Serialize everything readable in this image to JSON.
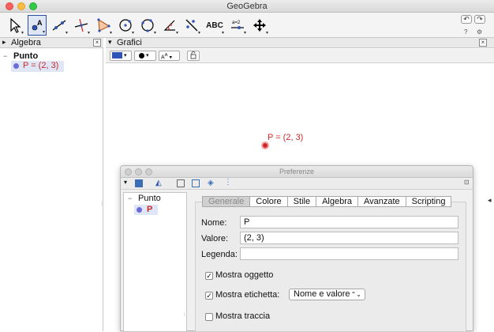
{
  "window": {
    "title": "GeoGebra"
  },
  "toolbar": {
    "tools": [
      {
        "name": "move-tool"
      },
      {
        "name": "point-tool"
      },
      {
        "name": "line-tool"
      },
      {
        "name": "perpendicular-line-tool"
      },
      {
        "name": "polygon-tool"
      },
      {
        "name": "circle-center-tool"
      },
      {
        "name": "circle-three-points-tool"
      },
      {
        "name": "angle-tool"
      },
      {
        "name": "reflect-tool"
      },
      {
        "name": "text-tool",
        "label": "ABC"
      },
      {
        "name": "slider-tool",
        "label": "a=2"
      },
      {
        "name": "move-graphics-tool"
      }
    ],
    "undo_symbol": "↶",
    "redo_symbol": "↷",
    "help_symbol": "?",
    "settings_symbol": "⚙"
  },
  "algebra": {
    "title": "Algebra",
    "close": "×",
    "group_label": "Punto",
    "item": "P = (2, 3)"
  },
  "graphics": {
    "title": "Grafici",
    "close": "×",
    "point_label": "P = (2, 3)",
    "point_color": "#cc2a2a"
  },
  "preferences": {
    "title": "Preferenze",
    "tree_group": "Punto",
    "tree_item": "P",
    "tabs": [
      "Generale",
      "Colore",
      "Stile",
      "Algebra",
      "Avanzate",
      "Scripting"
    ],
    "active_tab": "Generale",
    "name_label": "Nome:",
    "name_value": "P",
    "value_label": "Valore:",
    "value_value": "(2, 3)",
    "caption_label": "Legenda:",
    "caption_value": "",
    "show_object_label": "Mostra oggetto",
    "show_object_checked": true,
    "show_label_label": "Mostra etichetta:",
    "show_label_checked": true,
    "label_mode": "Nome e valore",
    "show_trace_label": "Mostra traccia",
    "show_trace_checked": false
  }
}
